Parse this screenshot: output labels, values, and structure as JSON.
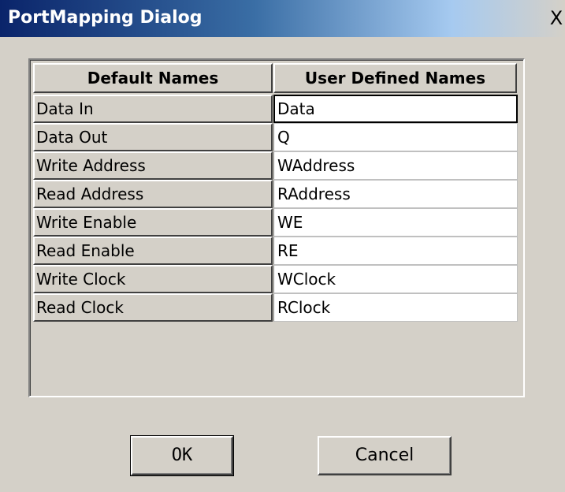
{
  "window": {
    "title": "PortMapping Dialog",
    "close_glyph": "X"
  },
  "grid": {
    "headers": [
      "Default Names",
      "User Defined Names"
    ],
    "rows": [
      {
        "default": "Data In",
        "user": "Data"
      },
      {
        "default": "Data Out",
        "user": "Q"
      },
      {
        "default": "Write Address",
        "user": "WAddress"
      },
      {
        "default": "Read Address",
        "user": "RAddress"
      },
      {
        "default": "Write Enable",
        "user": "WE"
      },
      {
        "default": "Read Enable",
        "user": "RE"
      },
      {
        "default": "Write Clock",
        "user": "WClock"
      },
      {
        "default": "Read Clock",
        "user": "RClock"
      }
    ]
  },
  "buttons": {
    "ok_label": "OK",
    "cancel_label": "Cancel"
  },
  "colors": {
    "title_bar_start": "#0a246a",
    "dialog_background": "#d4d0c8",
    "cell_background": "#ffffff"
  }
}
